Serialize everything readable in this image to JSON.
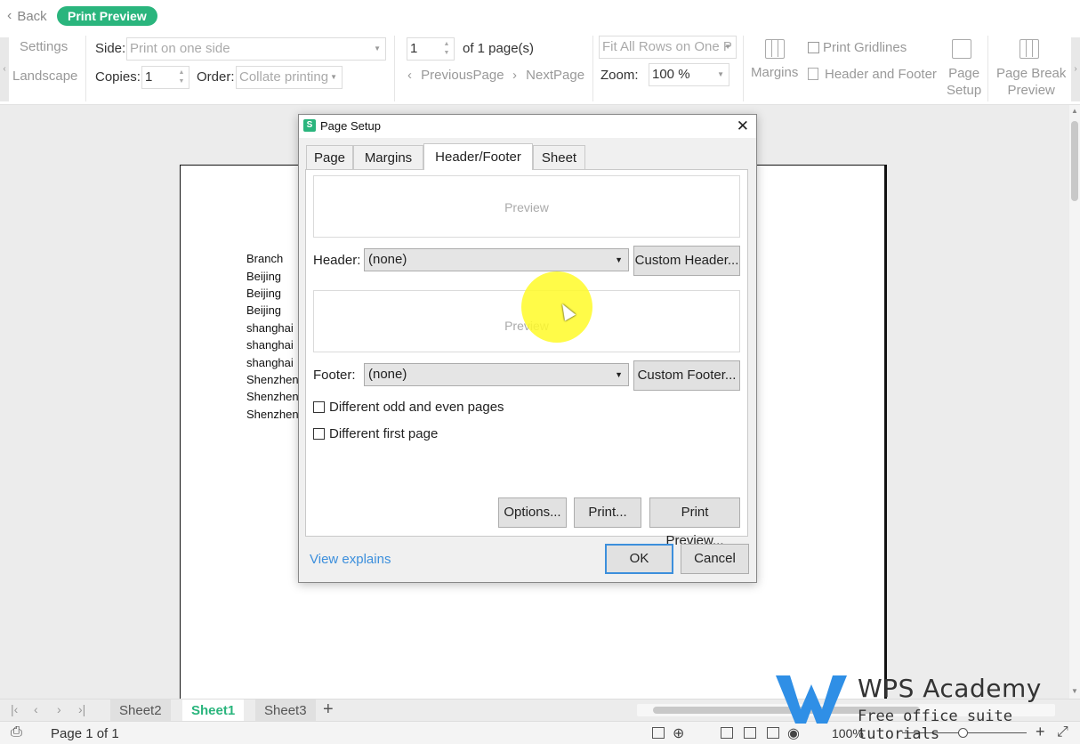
{
  "topbar": {
    "back_label": "Back",
    "mode_label": "Print Preview"
  },
  "ribbon": {
    "settings_label": "Settings",
    "landscape_label": "Landscape",
    "side_label": "Side:",
    "side_value": "Print on one side",
    "copies_label": "Copies:",
    "copies_value": "1",
    "order_label": "Order:",
    "order_value": "Collate printing",
    "page_value": "1",
    "page_of": "of 1 page(s)",
    "prev_page": "PreviousPage",
    "next_page": "NextPage",
    "fit_value": "Fit All Rows on One P",
    "zoom_label": "Zoom:",
    "zoom_value": "100 %",
    "margins_label": "Margins",
    "print_gridlines": "Print Gridlines",
    "header_footer": "Header and Footer",
    "page_setup_1": "Page",
    "page_setup_2": "Setup",
    "page_break_1": "Page Break",
    "page_break_2": "Preview"
  },
  "sheet_content": [
    "Branch",
    "Beijing",
    "Beijing",
    "Beijing",
    "shanghai",
    "shanghai",
    "shanghai",
    "Shenzhen",
    "Shenzhen",
    "Shenzhen"
  ],
  "dialog": {
    "title": "Page Setup",
    "tabs": [
      "Page",
      "Margins",
      "Header/Footer",
      "Sheet"
    ],
    "active_tab": "Header/Footer",
    "preview_label": "Preview",
    "header_label": "Header:",
    "header_value": "(none)",
    "custom_header": "Custom Header...",
    "footer_label": "Footer:",
    "footer_value": "(none)",
    "custom_footer": "Custom Footer...",
    "odd_even": "Different odd and even pages",
    "first_page": "Different first page",
    "options_btn": "Options...",
    "print_btn": "Print...",
    "print_preview_btn": "Print Preview...",
    "view_explains": "View explains",
    "ok_btn": "OK",
    "cancel_btn": "Cancel"
  },
  "sheets": {
    "tabs": [
      "Sheet2",
      "Sheet1",
      "Sheet3"
    ],
    "active": "Sheet1"
  },
  "status": {
    "page_info": "Page 1 of 1",
    "zoom": "100%"
  },
  "watermark": {
    "title": "WPS Academy",
    "subtitle": "Free office suite tutorials"
  },
  "colors": {
    "accent": "#2ab57d",
    "link": "#3c8fdc"
  }
}
